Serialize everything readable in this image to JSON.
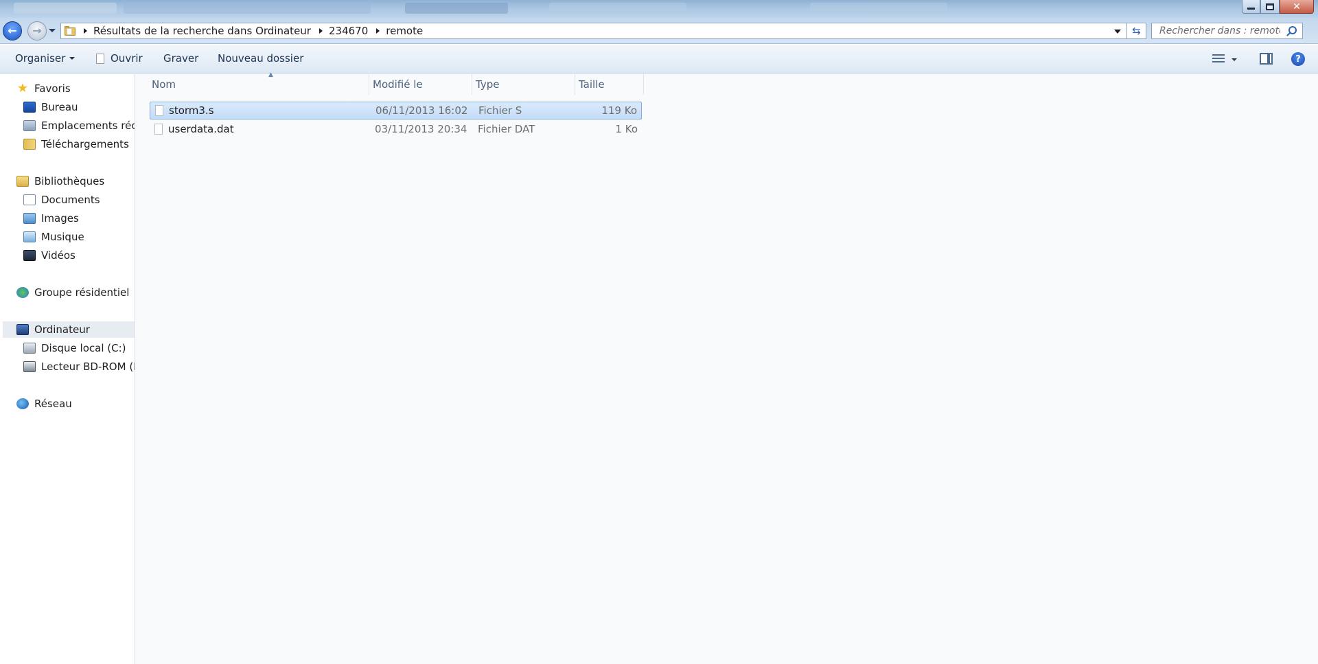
{
  "window": {
    "title_bar_controls": [
      "minimize",
      "maximize",
      "close"
    ]
  },
  "nav": {
    "breadcrumb": [
      "Résultats de la recherche dans Ordinateur",
      "234670",
      "remote"
    ],
    "search_placeholder": "Rechercher dans : remote"
  },
  "toolbar": {
    "organize": "Organiser",
    "open": "Ouvrir",
    "burn": "Graver",
    "new_folder": "Nouveau dossier"
  },
  "sidebar": {
    "favorites": "Favoris",
    "bureau": "Bureau",
    "recent": "Emplacements récen",
    "downloads": "Téléchargements",
    "libraries": "Bibliothèques",
    "documents": "Documents",
    "images": "Images",
    "music": "Musique",
    "videos": "Vidéos",
    "homegroup": "Groupe résidentiel",
    "computer": "Ordinateur",
    "local_disk": "Disque local (C:)",
    "bd_drive": "Lecteur BD-ROM (E:)",
    "network": "Réseau"
  },
  "columns": {
    "name": "Nom",
    "modified": "Modifié le",
    "type": "Type",
    "size": "Taille"
  },
  "files": [
    {
      "name": "storm3.s",
      "modified": "06/11/2013 16:02",
      "type": "Fichier S",
      "size": "119 Ko",
      "selected": true
    },
    {
      "name": "userdata.dat",
      "modified": "03/11/2013 20:34",
      "type": "Fichier DAT",
      "size": "1 Ko",
      "selected": false
    }
  ],
  "colors": {
    "selection": "#c4dcf7",
    "accent": "#1b55c2"
  }
}
